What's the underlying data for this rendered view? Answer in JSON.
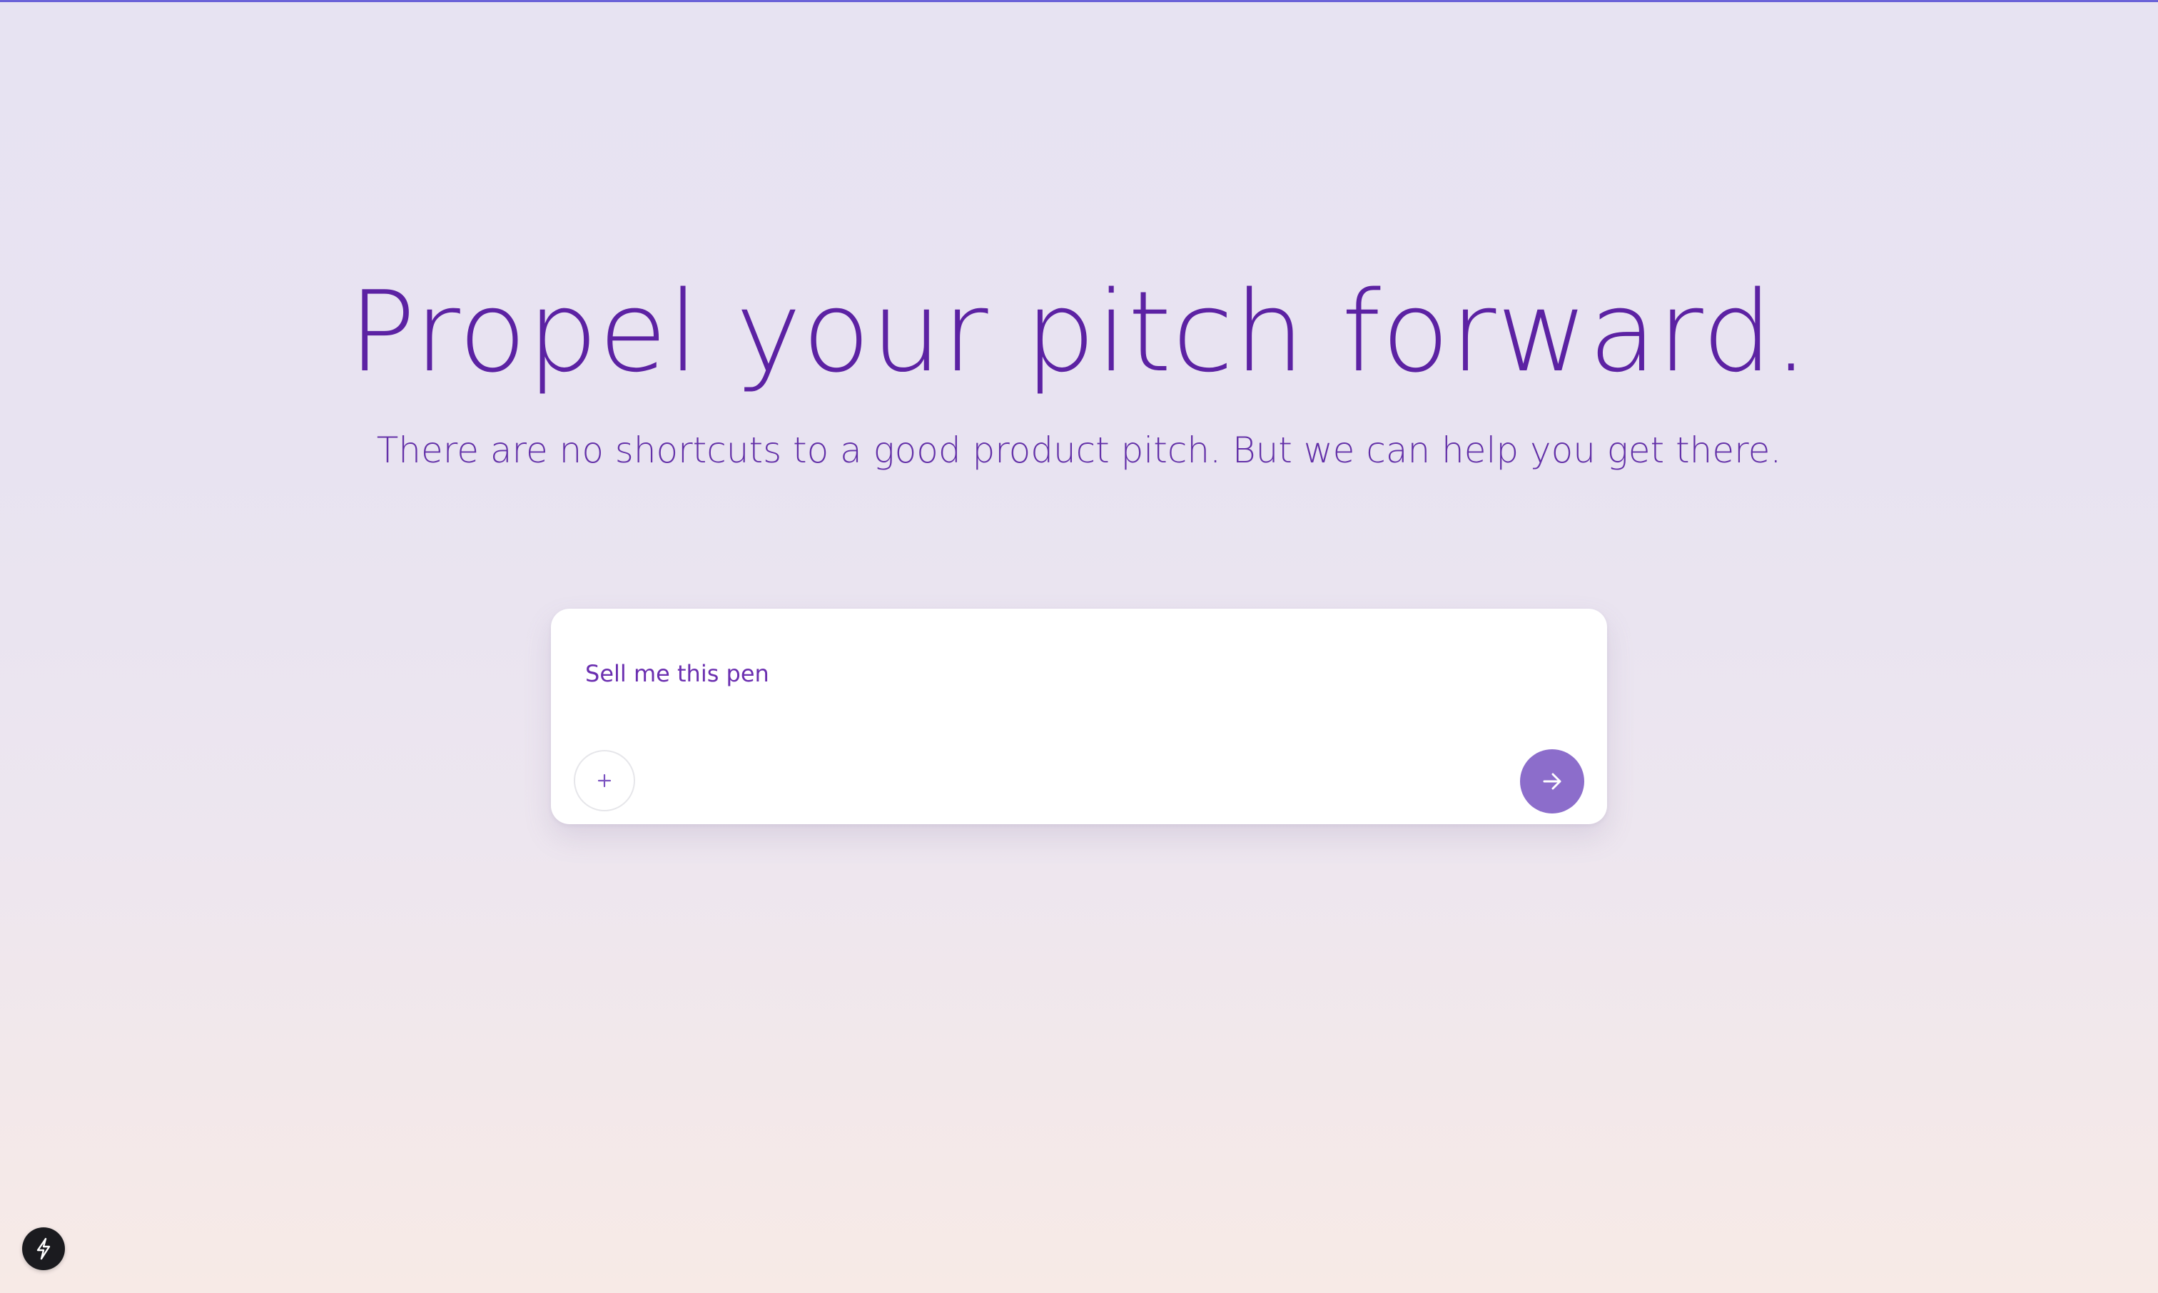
{
  "hero": {
    "title": "Propel your pitch forward.",
    "subtitle": "There are no shortcuts to a good product pitch. But we can help you get there."
  },
  "composer": {
    "text": "Sell me this pen",
    "attach_icon": "plus-icon",
    "submit_icon": "arrow-right-icon"
  },
  "badge": {
    "icon": "lightning-icon"
  },
  "colors": {
    "title": "#5c22a3",
    "subtitle": "#6330a8",
    "accent": "#8c6dcb",
    "top_line": "#6b63d8",
    "badge_bg": "#1b1b1f"
  }
}
